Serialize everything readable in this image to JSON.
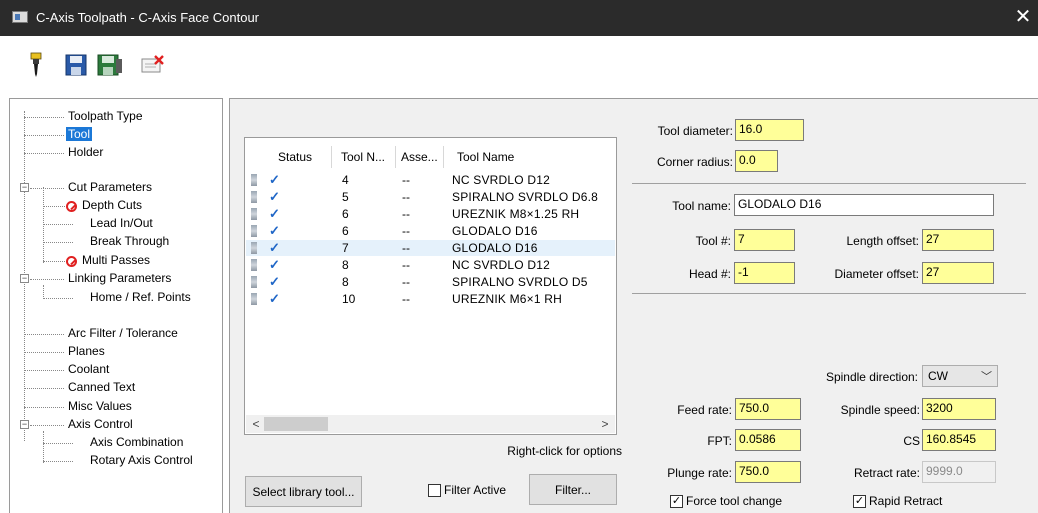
{
  "window": {
    "title": "C-Axis Toolpath - C-Axis Face Contour",
    "close": "✕"
  },
  "toolbar": {
    "icons": [
      "tool-icon",
      "save-icon",
      "save-library-icon",
      "delete-icon"
    ]
  },
  "tree": {
    "items": [
      {
        "label": "Toolpath Type"
      },
      {
        "label": "Tool"
      },
      {
        "label": "Holder"
      },
      {
        "label": "Cut Parameters"
      },
      {
        "label": "Depth Cuts"
      },
      {
        "label": "Lead In/Out"
      },
      {
        "label": "Break Through"
      },
      {
        "label": "Multi Passes"
      },
      {
        "label": "Linking Parameters"
      },
      {
        "label": "Home / Ref. Points"
      },
      {
        "label": "Arc Filter / Tolerance"
      },
      {
        "label": "Planes"
      },
      {
        "label": "Coolant"
      },
      {
        "label": "Canned Text"
      },
      {
        "label": "Misc Values"
      },
      {
        "label": "Axis Control"
      },
      {
        "label": "Axis Combination"
      },
      {
        "label": "Rotary Axis Control"
      }
    ],
    "selected": "Tool"
  },
  "tool_list": {
    "columns": [
      "Status",
      "Tool N...",
      "Asse...",
      "Tool Name"
    ],
    "rows": [
      {
        "status": "✓",
        "num": "4",
        "asm": "--",
        "name": "NC SVRDLO  D12"
      },
      {
        "status": "✓",
        "num": "5",
        "asm": "--",
        "name": "SPIRALNO SVRDLO D6.8"
      },
      {
        "status": "✓",
        "num": "6",
        "asm": "--",
        "name": "UREZNIK M8×1.25 RH"
      },
      {
        "status": "✓",
        "num": "6",
        "asm": "--",
        "name": "GLODALO D16"
      },
      {
        "status": "✓",
        "num": "7",
        "asm": "--",
        "name": "GLODALO D16"
      },
      {
        "status": "✓",
        "num": "8",
        "asm": "--",
        "name": "NC SVRDLO D12"
      },
      {
        "status": "✓",
        "num": "8",
        "asm": "--",
        "name": "SPIRALNO SVRDLO D5"
      },
      {
        "status": "✓",
        "num": "10",
        "asm": "--",
        "name": "UREZNIK M6×1 RH"
      }
    ],
    "scroll_left": "<",
    "scroll_right": ">",
    "hint": "Right-click for options"
  },
  "buttons": {
    "select_library": "Select library tool...",
    "filter": "Filter..."
  },
  "filter_active": {
    "label": "Filter Active",
    "checked": false
  },
  "fields": {
    "tool_diameter": {
      "label": "Tool diameter:",
      "value": "16.0"
    },
    "corner_radius": {
      "label": "Corner radius:",
      "value": "0.0"
    },
    "tool_name": {
      "label": "Tool name:",
      "value": "GLODALO D16"
    },
    "tool_num": {
      "label": "Tool #:",
      "value": "7"
    },
    "length_offset": {
      "label": "Length offset:",
      "value": "27"
    },
    "head_num": {
      "label": "Head #:",
      "value": "-1"
    },
    "diameter_offset": {
      "label": "Diameter offset:",
      "value": "27"
    },
    "spindle_direction": {
      "label": "Spindle direction:",
      "value": "CW"
    },
    "feed_rate": {
      "label": "Feed rate:",
      "value": "750.0"
    },
    "spindle_speed": {
      "label": "Spindle speed:",
      "value": "3200"
    },
    "fpt": {
      "label": "FPT:",
      "value": "0.0586"
    },
    "cs": {
      "label": "CS",
      "value": "160.8545"
    },
    "plunge_rate": {
      "label": "Plunge rate:",
      "value": "750.0"
    },
    "retract_rate": {
      "label": "Retract rate:",
      "value": "9999.0"
    }
  },
  "checkboxes": {
    "force_tool_change": {
      "label": "Force tool change",
      "checked": true
    },
    "rapid_retract": {
      "label": "Rapid Retract",
      "checked": true
    }
  },
  "colors": {
    "field_yellow": "#ffff99",
    "selection_blue": "#1b78d7",
    "check_blue": "#1f66c7",
    "no_red": "#e02020"
  }
}
